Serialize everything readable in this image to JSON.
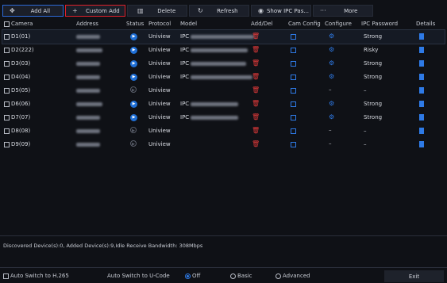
{
  "toolbar": {
    "add_all": "Add All",
    "custom_add": "Custom Add",
    "delete": "Delete",
    "refresh": "Refresh",
    "show_ipc": "Show IPC Pas...",
    "more": "More"
  },
  "columns": {
    "camera": "Camera",
    "address": "Address",
    "status": "Status",
    "protocol": "Protocol",
    "model": "Model",
    "adddel": "Add/Del",
    "camconfig": "Cam Config",
    "configure": "Configure",
    "ipcpassword": "IPC Password",
    "details": "Details"
  },
  "rows": [
    {
      "camera": "D1(01)",
      "protocol": "Uniview",
      "model": "IPC",
      "status": "online",
      "configure": "gear",
      "password": "Strong"
    },
    {
      "camera": "D2(222)",
      "protocol": "Uniview",
      "model": "IPC",
      "status": "online",
      "configure": "gear",
      "password": "Risky"
    },
    {
      "camera": "D3(03)",
      "protocol": "Uniview",
      "model": "IPC",
      "status": "online",
      "configure": "gear",
      "password": "Strong"
    },
    {
      "camera": "D4(04)",
      "protocol": "Uniview",
      "model": "IPC",
      "status": "online",
      "configure": "gear",
      "password": "Strong"
    },
    {
      "camera": "D5(05)",
      "protocol": "Uniview",
      "model": "",
      "status": "offline",
      "configure": "dash",
      "password": "–"
    },
    {
      "camera": "D6(06)",
      "protocol": "Uniview",
      "model": "IPC",
      "status": "online",
      "configure": "gear",
      "password": "Strong"
    },
    {
      "camera": "D7(07)",
      "protocol": "Uniview",
      "model": "IPC",
      "status": "online",
      "configure": "gear",
      "password": "Strong"
    },
    {
      "camera": "D8(08)",
      "protocol": "Uniview",
      "model": "",
      "status": "offline",
      "configure": "dash",
      "password": "–"
    },
    {
      "camera": "D9(09)",
      "protocol": "Uniview",
      "model": "",
      "status": "offline",
      "configure": "dash",
      "password": "–"
    }
  ],
  "status_text": "Discovered Device(s):0, Added Device(s):9,Idle Receive Bandwidth: 308Mbps",
  "bottom": {
    "auto_h265": "Auto Switch to H.265",
    "auto_ucode": "Auto Switch to U-Code",
    "off": "Off",
    "basic": "Basic",
    "advanced": "Advanced",
    "exit": "Exit"
  },
  "colors": {
    "accent": "#2e7ae6",
    "danger": "#e23a3a",
    "background": "#0f1116"
  }
}
